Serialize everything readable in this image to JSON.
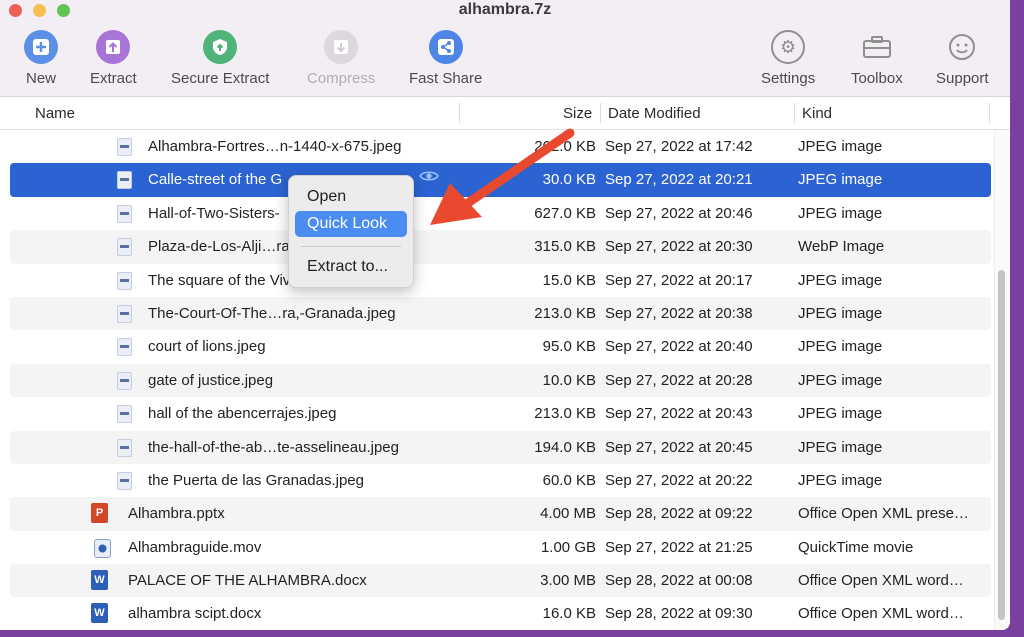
{
  "window": {
    "title": "alhambra.7z"
  },
  "toolbar": {
    "new": "New",
    "extract": "Extract",
    "secure_extract": "Secure Extract",
    "compress": "Compress",
    "fast_share": "Fast Share",
    "settings": "Settings",
    "toolbox": "Toolbox",
    "support": "Support"
  },
  "columns": {
    "name": "Name",
    "size": "Size",
    "date": "Date Modified",
    "kind": "Kind"
  },
  "files": [
    {
      "name": "Alhambra-Fortres…n-1440-x-675.jpeg",
      "size": "202.0 KB",
      "date": "Sep 27, 2022 at 17:42",
      "kind": "JPEG image"
    },
    {
      "name": "Calle-street of the G",
      "size": "30.0 KB",
      "date": "Sep 27, 2022 at 20:21",
      "kind": "JPEG image"
    },
    {
      "name": "Hall-of-Two-Sisters-",
      "size": "627.0 KB",
      "date": "Sep 27, 2022 at 20:46",
      "kind": "JPEG image"
    },
    {
      "name": "Plaza-de-Los-Alji…ra",
      "size": "315.0 KB",
      "date": "Sep 27, 2022 at 20:30",
      "kind": "WebP Image"
    },
    {
      "name": "The square of the Viv",
      "size": "15.0 KB",
      "date": "Sep 27, 2022 at 20:17",
      "kind": "JPEG image"
    },
    {
      "name": "The-Court-Of-The…ra,-Granada.jpeg",
      "size": "213.0 KB",
      "date": "Sep 27, 2022 at 20:38",
      "kind": "JPEG image"
    },
    {
      "name": "court of lions.jpeg",
      "size": "95.0 KB",
      "date": "Sep 27, 2022 at 20:40",
      "kind": "JPEG image"
    },
    {
      "name": "gate of justice.jpeg",
      "size": "10.0 KB",
      "date": "Sep 27, 2022 at 20:28",
      "kind": "JPEG image"
    },
    {
      "name": "hall of the abencerrajes.jpeg",
      "size": "213.0 KB",
      "date": "Sep 27, 2022 at 20:43",
      "kind": "JPEG image"
    },
    {
      "name": "the-hall-of-the-ab…te-asselineau.jpeg",
      "size": "194.0 KB",
      "date": "Sep 27, 2022 at 20:45",
      "kind": "JPEG image"
    },
    {
      "name": "the Puerta de las Granadas.jpeg",
      "size": "60.0 KB",
      "date": "Sep 27, 2022 at 20:22",
      "kind": "JPEG image"
    },
    {
      "name": "Alhambra.pptx",
      "size": "4.00 MB",
      "date": "Sep 28, 2022 at 09:22",
      "kind": "Office Open XML prese…"
    },
    {
      "name": "Alhambraguide.mov",
      "size": "1.00 GB",
      "date": "Sep 27, 2022 at 21:25",
      "kind": "QuickTime movie"
    },
    {
      "name": "PALACE OF THE ALHAMBRA.docx",
      "size": "3.00 MB",
      "date": "Sep 28, 2022 at 00:08",
      "kind": "Office Open XML word…"
    },
    {
      "name": "alhambra scipt.docx",
      "size": "16.0 KB",
      "date": "Sep 28, 2022 at 09:30",
      "kind": "Office Open XML word…"
    }
  ],
  "context_menu": {
    "open": "Open",
    "quick_look": "Quick Look",
    "extract_to": "Extract to..."
  },
  "badges": {
    "pptx": "P",
    "docx": "W"
  },
  "colors": {
    "selection": "#2c63d2",
    "arrow": "#e8492f",
    "menu_highlight": "#4a8cf0"
  }
}
